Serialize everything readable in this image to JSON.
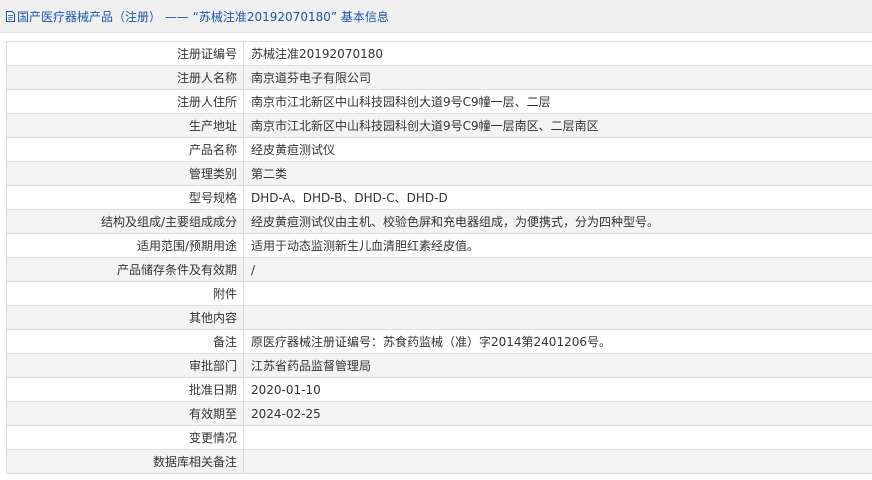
{
  "header": {
    "prefix": "国产医疗器械产品（注册）",
    "separator": " —— ",
    "quote_open": "“",
    "reg_no": "苏械注准20192070180",
    "quote_close": "”",
    "suffix": "基本信息",
    "icon": "document-icon"
  },
  "colors": {
    "header_text": "#1a56a8",
    "header_bg": "#f0f0f0",
    "row_alt_bg": "#f3f3f3",
    "border": "#dcdcdc"
  },
  "rows": [
    {
      "label": "注册证编号",
      "value": "苏械注准20192070180"
    },
    {
      "label": "注册人名称",
      "value": "南京道芬电子有限公司"
    },
    {
      "label": "注册人住所",
      "value": "南京市江北新区中山科技园科创大道9号C9幢一层、二层"
    },
    {
      "label": "生产地址",
      "value": "南京市江北新区中山科技园科创大道9号C9幢一层南区、二层南区"
    },
    {
      "label": "产品名称",
      "value": "经皮黄疸测试仪"
    },
    {
      "label": "管理类别",
      "value": "第二类"
    },
    {
      "label": "型号规格",
      "value": "DHD-A、DHD-B、DHD-C、DHD-D"
    },
    {
      "label": "结构及组成/主要组成成分",
      "value": "经皮黄疸测试仪由主机、校验色屏和充电器组成，为便携式，分为四种型号。"
    },
    {
      "label": "适用范围/预期用途",
      "value": "适用于动态监测新生儿血清胆红素经皮值。"
    },
    {
      "label": "产品储存条件及有效期",
      "value": "/"
    },
    {
      "label": "附件",
      "value": ""
    },
    {
      "label": "其他内容",
      "value": ""
    },
    {
      "label": "备注",
      "value": "原医疗器械注册证编号：苏食药监械（准）字2014第2401206号。"
    },
    {
      "label": "审批部门",
      "value": "江苏省药品监督管理局"
    },
    {
      "label": "批准日期",
      "value": "2020-01-10"
    },
    {
      "label": "有效期至",
      "value": "2024-02-25"
    },
    {
      "label": "变更情况",
      "value": ""
    },
    {
      "label": "数据库相关备注",
      "value": ""
    }
  ]
}
